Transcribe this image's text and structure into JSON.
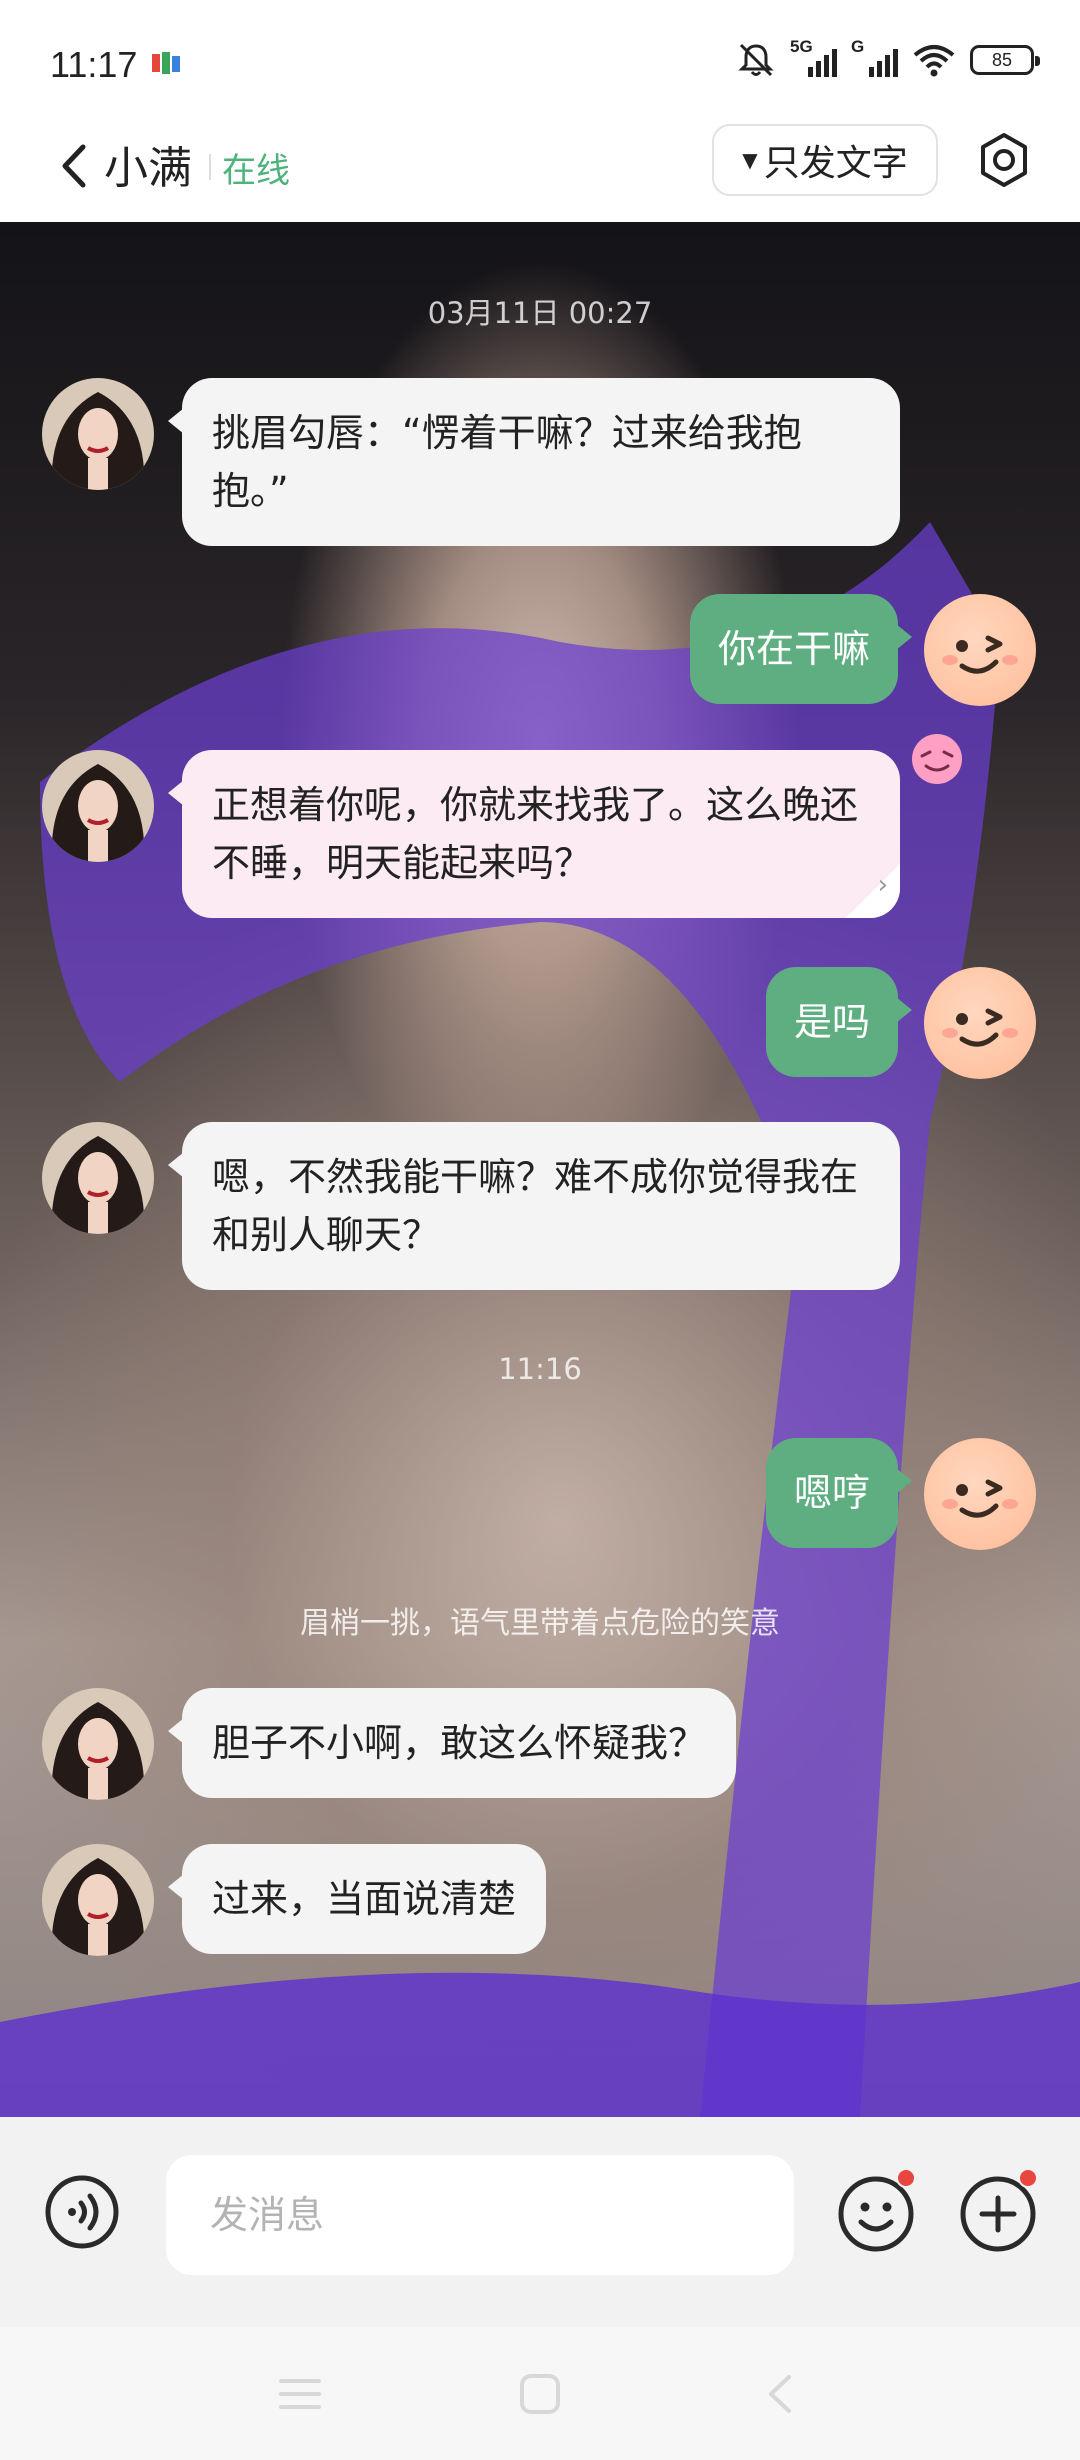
{
  "status_bar": {
    "time": "11:17",
    "network_1": "5G",
    "network_2": "G",
    "battery": "85"
  },
  "header": {
    "contact_name": "小满",
    "online_status": "在线",
    "text_only_label": "只发文字"
  },
  "messages": [
    {
      "type": "timestamp",
      "text": "03月11日 00:27"
    },
    {
      "type": "incoming",
      "text": "挑眉勾唇：“愣着干嘛？过来给我抱抱。”"
    },
    {
      "type": "outgoing",
      "text": "你在干嘛"
    },
    {
      "type": "incoming",
      "text": "正想着你呢，你就来找我了。这么晚还不睡，明天能起来吗？"
    },
    {
      "type": "outgoing",
      "text": "是吗"
    },
    {
      "type": "incoming",
      "text": "嗯，不然我能干嘛？难不成你觉得我在和别人聊天？"
    },
    {
      "type": "timestamp",
      "text": "11:16"
    },
    {
      "type": "outgoing",
      "text": "嗯哼"
    },
    {
      "type": "narration",
      "text": "眉梢一挑，语气里带着点危险的笑意"
    },
    {
      "type": "incoming",
      "text": "胆子不小啊，敢这么怀疑我？"
    },
    {
      "type": "incoming",
      "text": "过来，当面说清楚"
    }
  ],
  "input": {
    "placeholder": "发消息"
  },
  "colors": {
    "accent_green": "#5fae82",
    "online_green": "#4db37b",
    "badge_red": "#e9463f",
    "incoming_bubble": "#f4f4f4",
    "pink_bubble": "#fcebf2"
  }
}
